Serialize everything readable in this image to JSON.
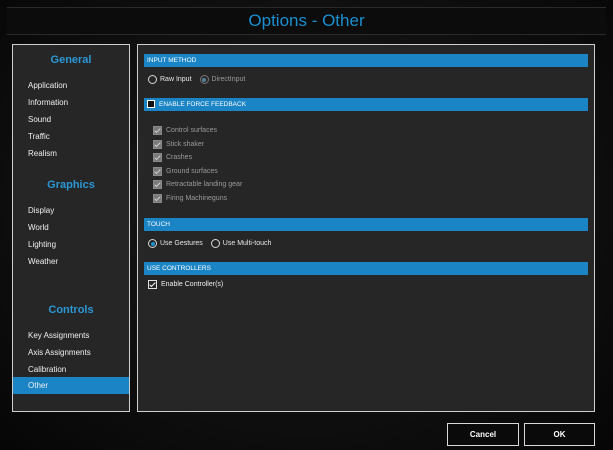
{
  "window": {
    "title": "Options - Other"
  },
  "sidebar": {
    "groups": [
      {
        "heading": "General",
        "items": [
          {
            "label": "Application"
          },
          {
            "label": "Information"
          },
          {
            "label": "Sound"
          },
          {
            "label": "Traffic"
          },
          {
            "label": "Realism"
          }
        ]
      },
      {
        "heading": "Graphics",
        "items": [
          {
            "label": "Display"
          },
          {
            "label": "World"
          },
          {
            "label": "Lighting"
          },
          {
            "label": "Weather"
          }
        ]
      },
      {
        "heading": "Controls",
        "items": [
          {
            "label": "Key Assignments"
          },
          {
            "label": "Axis Assignments"
          },
          {
            "label": "Calibration"
          },
          {
            "label": "Other",
            "active": true
          }
        ]
      }
    ]
  },
  "input_method": {
    "header": "INPUT METHOD",
    "options": [
      {
        "label": "Raw Input",
        "selected": false
      },
      {
        "label": "DirectInput",
        "selected": true,
        "disabled": true
      }
    ]
  },
  "force_feedback": {
    "header": "ENABLE FORCE FEEDBACK",
    "checked": false,
    "items": [
      {
        "label": "Control surfaces",
        "checked": true
      },
      {
        "label": "Stick shaker",
        "checked": true
      },
      {
        "label": "Crashes",
        "checked": true
      },
      {
        "label": "Ground surfaces",
        "checked": true
      },
      {
        "label": "Retractable landing gear",
        "checked": true
      },
      {
        "label": "Firing Machineguns",
        "checked": true
      }
    ]
  },
  "touch": {
    "header": "TOUCH",
    "options": [
      {
        "label": "Use Gestures",
        "selected": true
      },
      {
        "label": "Use Multi-touch",
        "selected": false
      }
    ]
  },
  "controllers": {
    "header": "USE CONTROLLERS",
    "enable_label": "Enable Controller(s)",
    "enable_checked": true
  },
  "buttons": {
    "cancel": "Cancel",
    "ok": "OK"
  },
  "colors": {
    "accent": "#1b84c4",
    "title_text": "#1b8fcf"
  }
}
